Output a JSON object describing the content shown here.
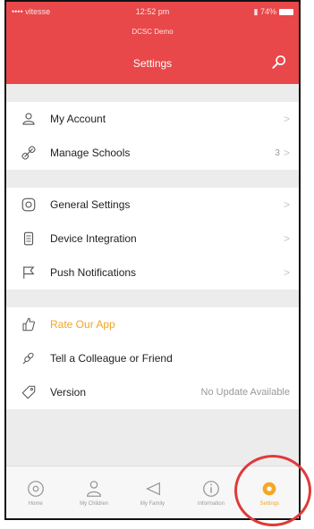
{
  "status": {
    "carrier": "•••• vitesse",
    "time": "12:52 pm",
    "battery": "▮ 74%"
  },
  "header": {
    "subtitle": "DCSC Demo",
    "title": "Settings",
    "search_icon": "search-icon"
  },
  "sections": [
    [
      {
        "label": "My Account",
        "icon": "user-icon",
        "chevron": ">"
      },
      {
        "label": "Manage Schools",
        "icon": "link-icon",
        "value": "3",
        "chevron": ">"
      }
    ],
    [
      {
        "label": "General Settings",
        "icon": "settings-icon",
        "chevron": ">"
      },
      {
        "label": "Device Integration",
        "icon": "device-icon",
        "chevron": ">"
      },
      {
        "label": "Push Notifications",
        "icon": "flag-icon",
        "chevron": ">"
      }
    ],
    [
      {
        "label": "Rate Our App",
        "icon": "thumbs-up-icon"
      },
      {
        "label": "Tell a Colleague or Friend",
        "icon": "share-icon"
      },
      {
        "label": "Version",
        "icon": "tag-icon",
        "value": "No Update Available"
      }
    ]
  ],
  "tabs": [
    {
      "label": "Home",
      "icon": "home-icon"
    },
    {
      "label": "My Children",
      "icon": "children-icon"
    },
    {
      "label": "My Family",
      "icon": "family-icon"
    },
    {
      "label": "Information",
      "icon": "info-icon"
    },
    {
      "label": "Settings",
      "icon": "settings-icon"
    }
  ],
  "colors": {
    "header": "#e8484a",
    "accent": "#f5a623",
    "highlight": "#e03a3a"
  }
}
